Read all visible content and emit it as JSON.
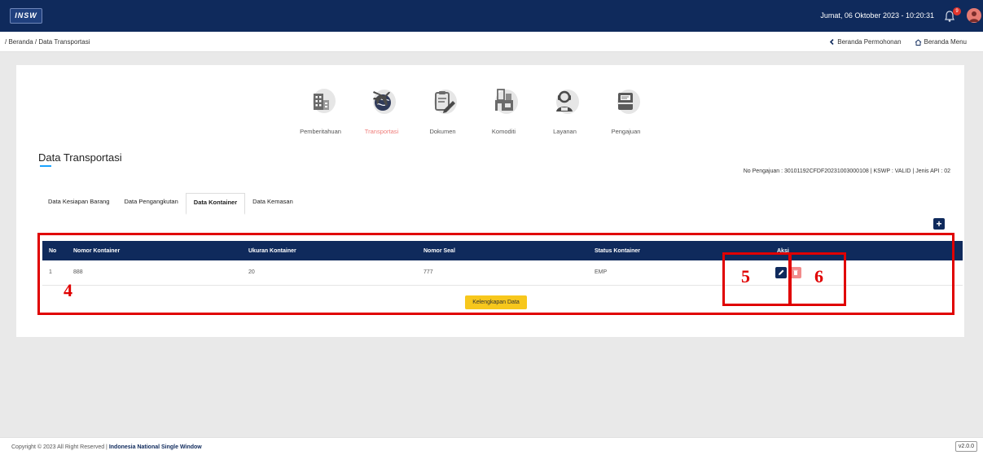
{
  "header": {
    "logo_text": "INSW",
    "datetime": "Jumat, 06 Oktober 2023 - 10:20:31",
    "notification_count": "9",
    "colors": {
      "topbar": "#0f2a5c",
      "accent": "#ef7c79"
    }
  },
  "subbar": {
    "breadcrumb": "/ Beranda / Data Transportasi",
    "link_permohonan": "Beranda Permohonan",
    "link_menu": "Beranda Menu"
  },
  "steps": [
    {
      "label": "Pemberitahuan",
      "icon": "building-icon",
      "active": false
    },
    {
      "label": "Transportasi",
      "icon": "globe-plane-icon",
      "active": true
    },
    {
      "label": "Dokumen",
      "icon": "clipboard-edit-icon",
      "active": false
    },
    {
      "label": "Komoditi",
      "icon": "warehouse-icon",
      "active": false
    },
    {
      "label": "Layanan",
      "icon": "support-agent-icon",
      "active": false
    },
    {
      "label": "Pengajuan",
      "icon": "folder-icon",
      "active": false
    }
  ],
  "page": {
    "title": "Data Transportasi",
    "info": "No Pengajuan : 30101192CFDF20231003000108 | KSWP : VALID | Jenis API : 02"
  },
  "tabs": [
    "Data Kesiapan Barang",
    "Data Pengangkutan",
    "Data Kontainer",
    "Data Kemasan"
  ],
  "active_tab": "Data Kontainer",
  "table": {
    "columns": [
      "No",
      "Nomor Kontainer",
      "Ukuran Kontainer",
      "Nomor Seal",
      "Status Kontainer",
      "Aksi"
    ],
    "rows": [
      {
        "no": "1",
        "nomor_kontainer": "888",
        "ukuran": "20",
        "seal": "777",
        "status": "EMP"
      }
    ]
  },
  "buttons": {
    "add": "+",
    "complete": "Kelengkapan Data"
  },
  "annotations": [
    "4",
    "5",
    "6"
  ],
  "footer": {
    "copyright": "Copyright © 2023 All Right Reserved |",
    "brand": "Indonesia National Single Window",
    "version": "v2.0.0"
  }
}
